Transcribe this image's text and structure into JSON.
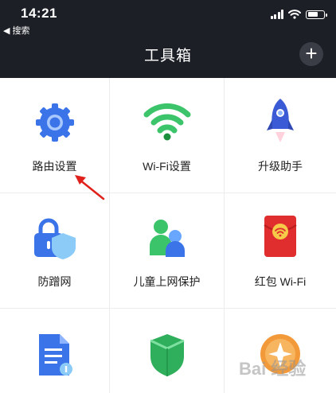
{
  "status_bar": {
    "time": "14:21",
    "back_label": "◀ 搜索"
  },
  "header": {
    "title": "工具箱",
    "add_symbol": "+"
  },
  "tools": [
    {
      "label": "路由设置",
      "icon": "gear-icon"
    },
    {
      "label": "Wi-Fi设置",
      "icon": "wifi-icon"
    },
    {
      "label": "升级助手",
      "icon": "rocket-icon"
    },
    {
      "label": "防蹭网",
      "icon": "lock-shield-icon"
    },
    {
      "label": "儿童上网保护",
      "icon": "parent-child-icon"
    },
    {
      "label": "红包 Wi-Fi",
      "icon": "red-envelope-icon"
    },
    {
      "label": "",
      "icon": "document-icon"
    },
    {
      "label": "",
      "icon": "green-shield-icon"
    },
    {
      "label": "",
      "icon": "orange-badge-icon"
    }
  ],
  "watermark": "Bai 经验",
  "colors": {
    "header_bg": "#1c1f26",
    "accent_blue": "#3a74e8",
    "wifi_green": "#3cc46b",
    "red": "#e02e2e",
    "arrow_red": "#e0211b"
  }
}
